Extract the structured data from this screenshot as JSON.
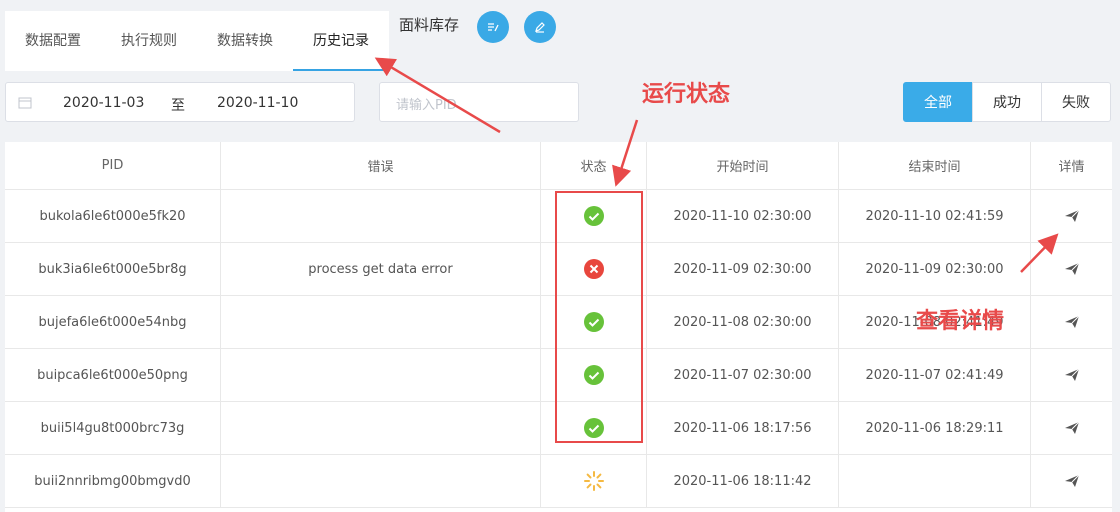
{
  "tabs": [
    "数据配置",
    "执行规则",
    "数据转换",
    "历史记录"
  ],
  "active_tab": "历史记录",
  "datasource_title": "面料库存",
  "date_range": {
    "start": "2020-11-03",
    "separator": "至",
    "end": "2020-11-10"
  },
  "pid_search": {
    "placeholder": "请输入PID",
    "value": ""
  },
  "filters": [
    "全部",
    "成功",
    "失败"
  ],
  "active_filter": "全部",
  "columns": {
    "pid": "PID",
    "error": "错误",
    "status": "状态",
    "start": "开始时间",
    "end": "结束时间",
    "detail": "详情"
  },
  "rows": [
    {
      "pid": "bukola6le6t000e5fk20",
      "error": "",
      "status": "success",
      "start": "2020-11-10 02:30:00",
      "end": "2020-11-10 02:41:59"
    },
    {
      "pid": "buk3ia6le6t000e5br8g",
      "error": "process get data error",
      "status": "failed",
      "start": "2020-11-09 02:30:00",
      "end": "2020-11-09 02:30:00"
    },
    {
      "pid": "bujefa6le6t000e54nbg",
      "error": "",
      "status": "success",
      "start": "2020-11-08 02:30:00",
      "end": "2020-11-08 02:41:49"
    },
    {
      "pid": "buipca6le6t000e50png",
      "error": "",
      "status": "success",
      "start": "2020-11-07 02:30:00",
      "end": "2020-11-07 02:41:49"
    },
    {
      "pid": "buii5l4gu8t000brc73g",
      "error": "",
      "status": "success",
      "start": "2020-11-06 18:17:56",
      "end": "2020-11-06 18:29:11"
    },
    {
      "pid": "buii2nnribmg00bmgvd0",
      "error": "",
      "status": "running",
      "start": "2020-11-06 18:11:42",
      "end": ""
    }
  ],
  "annotations": {
    "status_label": "运行状态",
    "detail_label": "查看详情"
  },
  "colors": {
    "primary": "#3aabe8",
    "success": "#67c23a",
    "error": "#e8463d",
    "running": "#f5b942",
    "annotation": "#e84a4a"
  },
  "icons": {
    "date": "calendar-icon",
    "status_success": "check-circle-icon",
    "status_failed": "close-circle-icon",
    "status_running": "loading-spinner-icon",
    "detail": "send-icon"
  }
}
